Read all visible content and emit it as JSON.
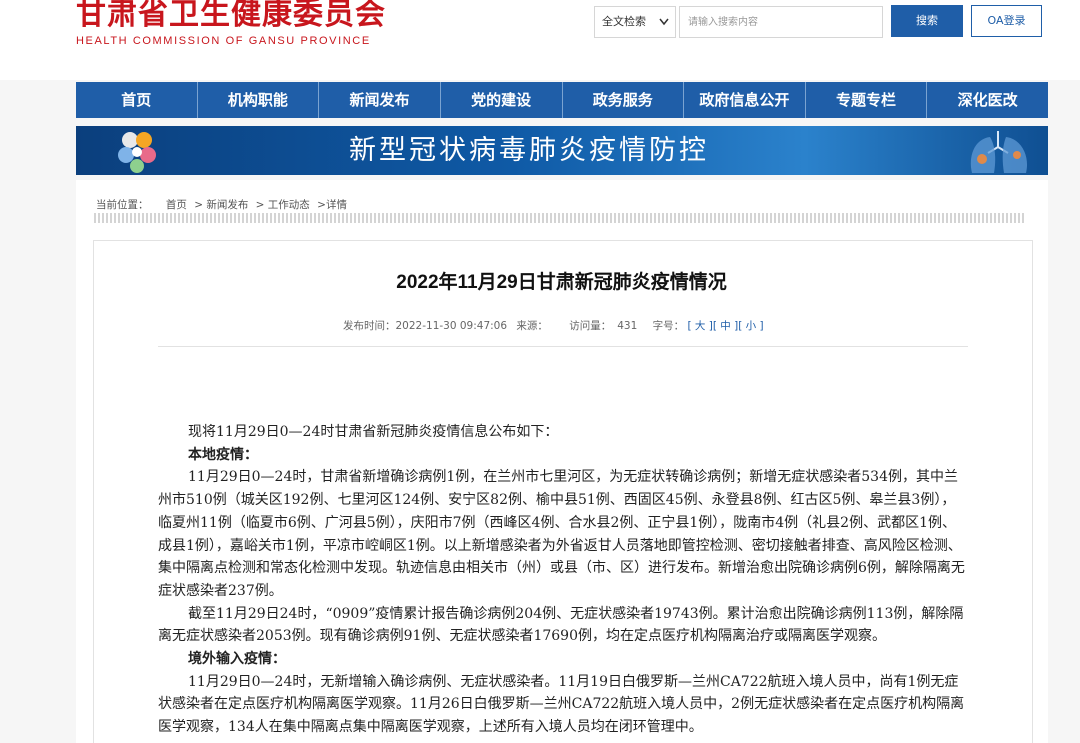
{
  "header": {
    "logo_cn": "甘肃省卫生健康委员会",
    "logo_en": "HEALTH  COMMISSION  OF  GANSU PROVINCE",
    "search_scope": "全文检索",
    "search_placeholder": "请输入搜索内容",
    "search_button": "搜索",
    "oa_button": "OA登录"
  },
  "nav": [
    "首页",
    "机构职能",
    "新闻发布",
    "党的建设",
    "政务服务",
    "政府信息公开",
    "专题专栏",
    "深化医改"
  ],
  "banner": {
    "text": "新型冠状病毒肺炎疫情防控"
  },
  "breadcrumb": {
    "label": "当前位置：",
    "items": [
      "首页",
      "> 新闻发布",
      "> 工作动态",
      ">详情"
    ]
  },
  "article": {
    "title": "2022年11月29日甘肃新冠肺炎疫情情况",
    "publish_label": "发布时间：",
    "publish_time": "2022-11-30 09:47:06",
    "source_label": "来源：",
    "views_label": "访问量：",
    "views": "431",
    "font_label": "字号：",
    "font_large": "[ 大 ]",
    "font_medium": "[ 中 ]",
    "font_small": "[ 小 ]",
    "paragraphs": [
      {
        "bold": false,
        "text": "现将11月29日0—24时甘肃省新冠肺炎疫情信息公布如下："
      },
      {
        "bold": true,
        "text": "本地疫情："
      },
      {
        "bold": false,
        "text": "11月29日0—24时，甘肃省新增确诊病例1例，在兰州市七里河区，为无症状转确诊病例；新增无症状感染者534例，其中兰州市510例（城关区192例、七里河区124例、安宁区82例、榆中县51例、西固区45例、永登县8例、红古区5例、皋兰县3例），临夏州11例（临夏市6例、广河县5例），庆阳市7例（西峰区4例、合水县2例、正宁县1例），陇南市4例（礼县2例、武都区1例、成县1例），嘉峪关市1例，平凉市崆峒区1例。以上新增感染者为外省返甘人员落地即管控检测、密切接触者排查、高风险区检测、集中隔离点检测和常态化检测中发现。轨迹信息由相关市（州）或县（市、区）进行发布。新增治愈出院确诊病例6例，解除隔离无症状感染者237例。"
      },
      {
        "bold": false,
        "text": "截至11月29日24时，“0909”疫情累计报告确诊病例204例、无症状感染者19743例。累计治愈出院确诊病例113例，解除隔离无症状感染者2053例。现有确诊病例91例、无症状感染者17690例，均在定点医疗机构隔离治疗或隔离医学观察。"
      },
      {
        "bold": true,
        "text": "境外输入疫情："
      },
      {
        "bold": false,
        "text": "11月29日0—24时，无新增输入确诊病例、无症状感染者。11月19日白俄罗斯—兰州CA722航班入境人员中，尚有1例无症状感染者在定点医疗机构隔离医学观察。11月26日白俄罗斯—兰州CA722航班入境人员中，2例无症状感染者在定点医疗机构隔离医学观察，134人在集中隔离点集中隔离医学观察，上述所有入境人员均在闭环管理中。"
      }
    ]
  }
}
